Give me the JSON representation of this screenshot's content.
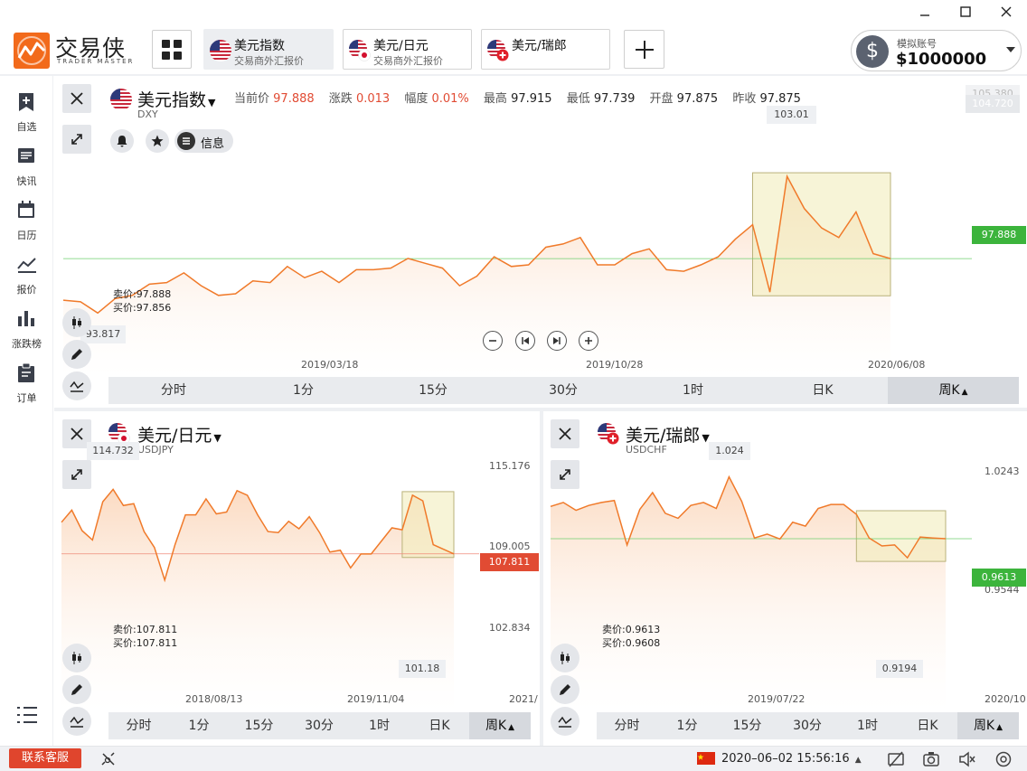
{
  "window": {
    "minimize": "—",
    "maximize": "☐",
    "close": "✕"
  },
  "brand": {
    "name": "交易侠",
    "subtitle": "TRADER MASTER"
  },
  "tabs": [
    {
      "title": "美元指数",
      "sub": "交易商外汇报价",
      "flag": "us"
    },
    {
      "title": "美元/日元",
      "sub": "交易商外汇报价",
      "flag": "us-jp"
    },
    {
      "title": "美元/瑞郎",
      "sub": "",
      "flag": "us-ch"
    }
  ],
  "account": {
    "label": "模拟账号",
    "value": "$1000000",
    "icon": "dollar-icon"
  },
  "sidebar": [
    {
      "label": "自选",
      "icon": "bookmark-plus-icon"
    },
    {
      "label": "快讯",
      "icon": "news-icon"
    },
    {
      "label": "日历",
      "icon": "calendar-icon"
    },
    {
      "label": "报价",
      "icon": "line-chart-icon"
    },
    {
      "label": "涨跌榜",
      "icon": "bar-chart-icon"
    },
    {
      "label": "订单",
      "icon": "clipboard-icon"
    }
  ],
  "colors": {
    "accent": "#f26a1b",
    "line": "#f07a2a",
    "fill": "#fbd9bf",
    "green": "#3cb43c",
    "red": "#e14b33",
    "highlight": "#f5f0c8"
  },
  "dxy": {
    "title": "美元指数",
    "code": "DXY",
    "quote": {
      "current_label": "当前价",
      "current": "97.888",
      "change_label": "涨跌",
      "change": "0.013",
      "pct_label": "幅度",
      "pct": "0.01%",
      "high_label": "最高",
      "high": "97.915",
      "low_label": "最低",
      "low": "97.739",
      "open_label": "开盘",
      "open": "97.875",
      "prev_label": "昨收",
      "prev": "97.875"
    },
    "info_label": "信息",
    "axis_top": [
      "105.380",
      "104.720"
    ],
    "price_tag": "97.888",
    "high_callout": "103.01",
    "low_callout": "93.817",
    "sell": "卖价:97.888",
    "buy": "买价:97.856",
    "dates": [
      "2019/03/18",
      "2019/10/28",
      "2020/06/08"
    ]
  },
  "usdjpy": {
    "title": "美元/日元",
    "code": "USDJPY",
    "axis_right": [
      "115.176",
      "109.005",
      "102.834"
    ],
    "price_tag": "107.811",
    "high_callout": "114.732",
    "low_callout": "101.18",
    "sell": "卖价:107.811",
    "buy": "买价:107.811",
    "dates": [
      "2018/08/13",
      "2019/11/04",
      "2021/"
    ]
  },
  "usdchf": {
    "title": "美元/瑞郎",
    "code": "USDCHF",
    "axis_right": [
      "1.0243",
      "0.9544"
    ],
    "price_tag": "0.9613",
    "high_callout": "1.024",
    "low_callout": "0.9194",
    "sell": "卖价:0.9613",
    "buy": "买价:0.9608",
    "dates": [
      "2019/07/22",
      "2020/10"
    ]
  },
  "timeframes": [
    "分时",
    "1分",
    "15分",
    "30分",
    "1时",
    "日K",
    "周K"
  ],
  "status": {
    "support": "联系客服",
    "datetime": "2020–06–02 15:56:16"
  },
  "chart_data": [
    {
      "type": "area",
      "series": [
        {
          "values": [
            95.3,
            95.2,
            94.5,
            95.4,
            95.6,
            96.3,
            96.4,
            97.0,
            96.2,
            95.6,
            95.7,
            96.5,
            96.4,
            97.4,
            96.7,
            97.1,
            96.4,
            97.2,
            97.2,
            97.3,
            97.9,
            97.6,
            97.3,
            96.2,
            96.8,
            98.0,
            97.4,
            97.5,
            98.6,
            98.8,
            99.2,
            97.5,
            97.5,
            98.2,
            98.5,
            97.2,
            97.1,
            97.5,
            98.0,
            99.1,
            100.0,
            95.8,
            103.01,
            101.0,
            99.8,
            99.2,
            100.8,
            98.2,
            97.888
          ]
        }
      ],
      "ylim": [
        93,
        105.38
      ]
    },
    {
      "type": "area",
      "series": [
        {
          "values": [
            111.2,
            112.5,
            110.3,
            109.3,
            113.4,
            114.732,
            113.0,
            113.2,
            110.2,
            108.5,
            105.0,
            108.8,
            112.0,
            112.0,
            113.7,
            112.1,
            112.3,
            114.6,
            114.1,
            112.0,
            110.2,
            110.1,
            111.3,
            110.5,
            111.8,
            110.1,
            108.0,
            108.2,
            106.3,
            107.8,
            107.8,
            109.2,
            110.6,
            110.4,
            114.1,
            113.5,
            108.8,
            108.3,
            107.811
          ]
        }
      ],
      "ylim": [
        101,
        117
      ]
    },
    {
      "type": "area",
      "series": [
        {
          "values": [
            0.994,
            0.998,
            0.99,
            0.995,
            0.998,
            1.0,
            0.955,
            0.991,
            1.008,
            0.987,
            0.982,
            0.995,
            0.998,
            0.992,
            1.024,
            0.999,
            0.962,
            0.966,
            0.961,
            0.978,
            0.974,
            0.992,
            0.996,
            0.996,
            0.986,
            0.962,
            0.954,
            0.955,
            0.942,
            0.963,
            0.962,
            0.9613
          ]
        }
      ],
      "ylim": [
        0.9,
        1.04
      ]
    }
  ]
}
